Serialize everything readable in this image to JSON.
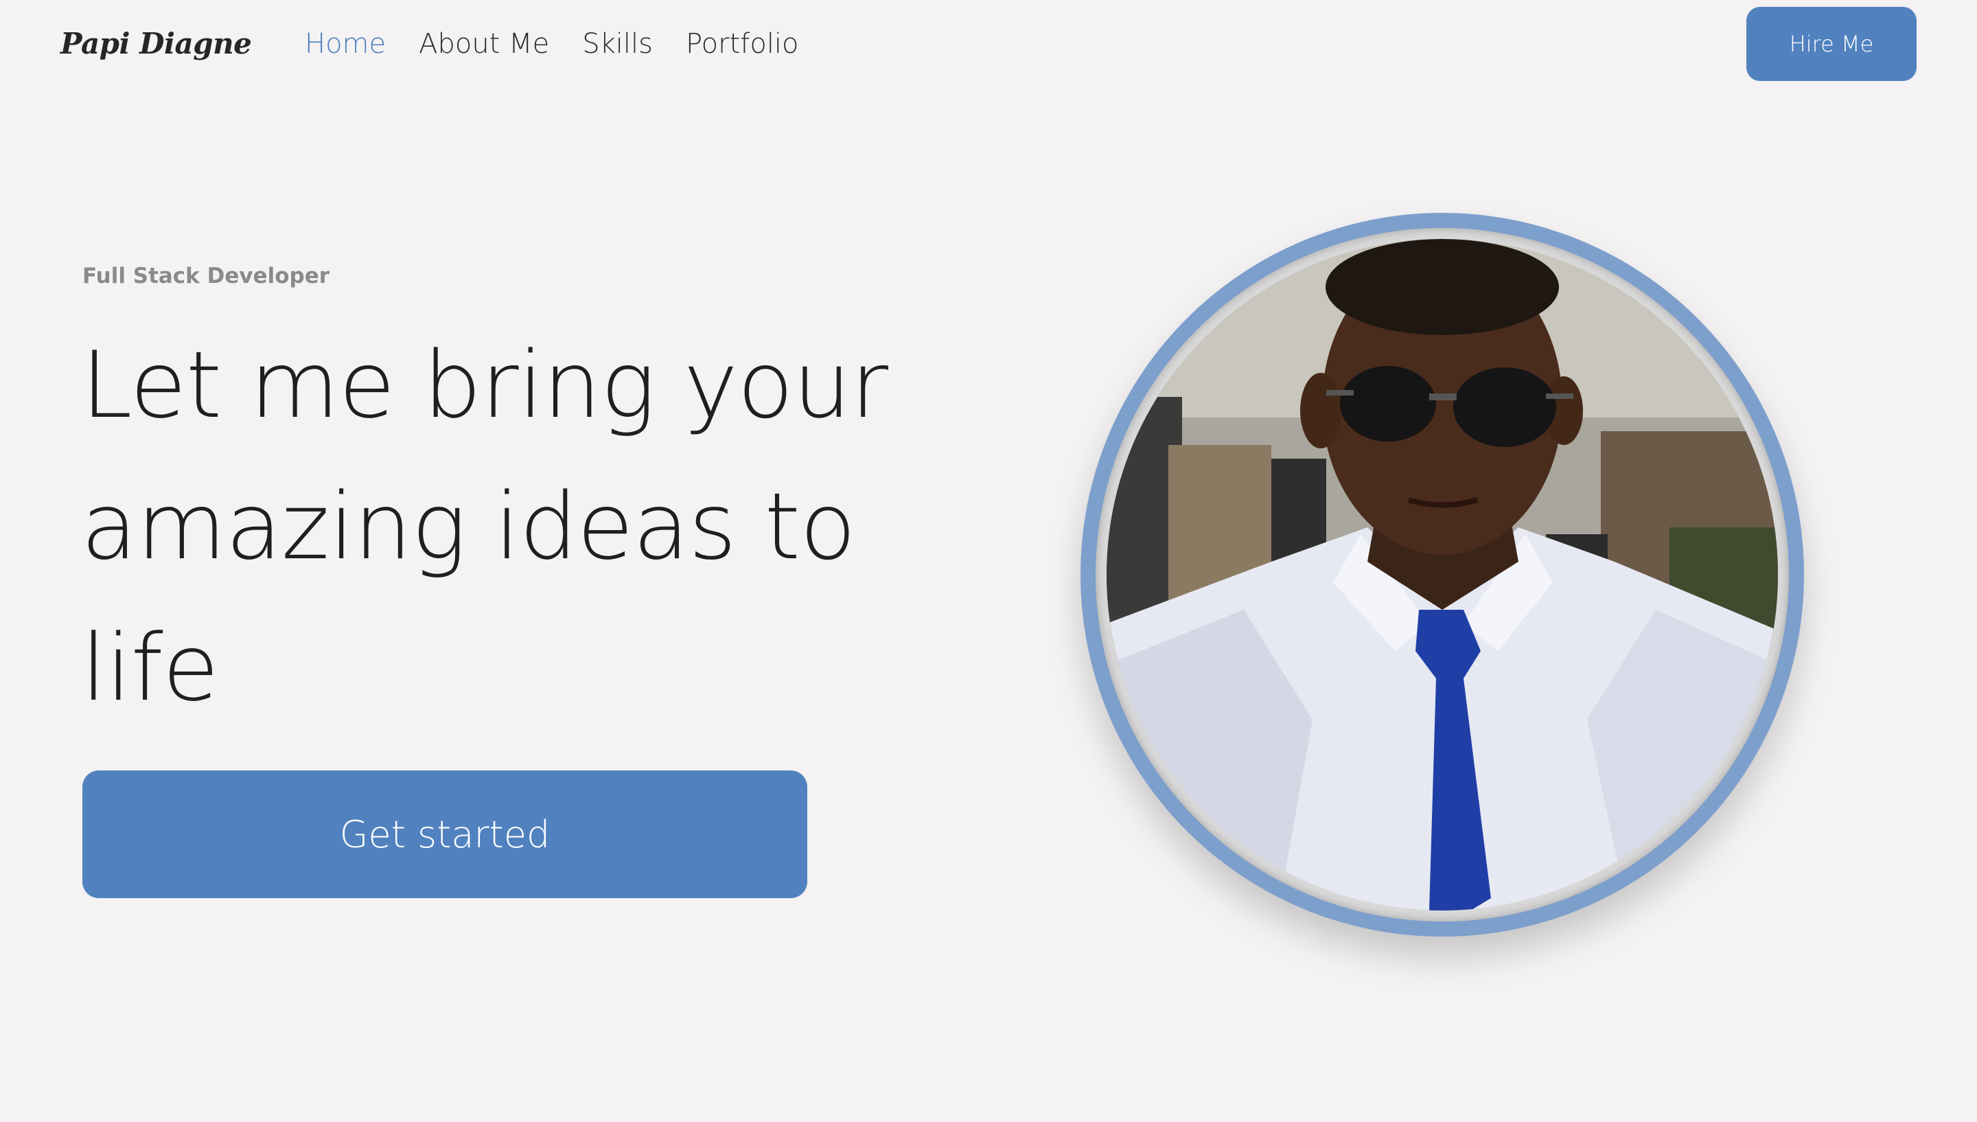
{
  "nav": {
    "logo": "Papi Diagne",
    "links": [
      "Home",
      "About Me",
      "Skills",
      "Portfolio"
    ],
    "active": "Home",
    "hire_label": "Hire Me"
  },
  "hero": {
    "subtitle": "Full Stack Developer",
    "headline": "Let me bring your amazing ideas to life",
    "cta_label": "Get started"
  },
  "portrait": {
    "alt": "profile-photo"
  },
  "colors": {
    "accent": "#5182bf",
    "background": "#f4f2f3",
    "ring": "#7d9fcc"
  }
}
